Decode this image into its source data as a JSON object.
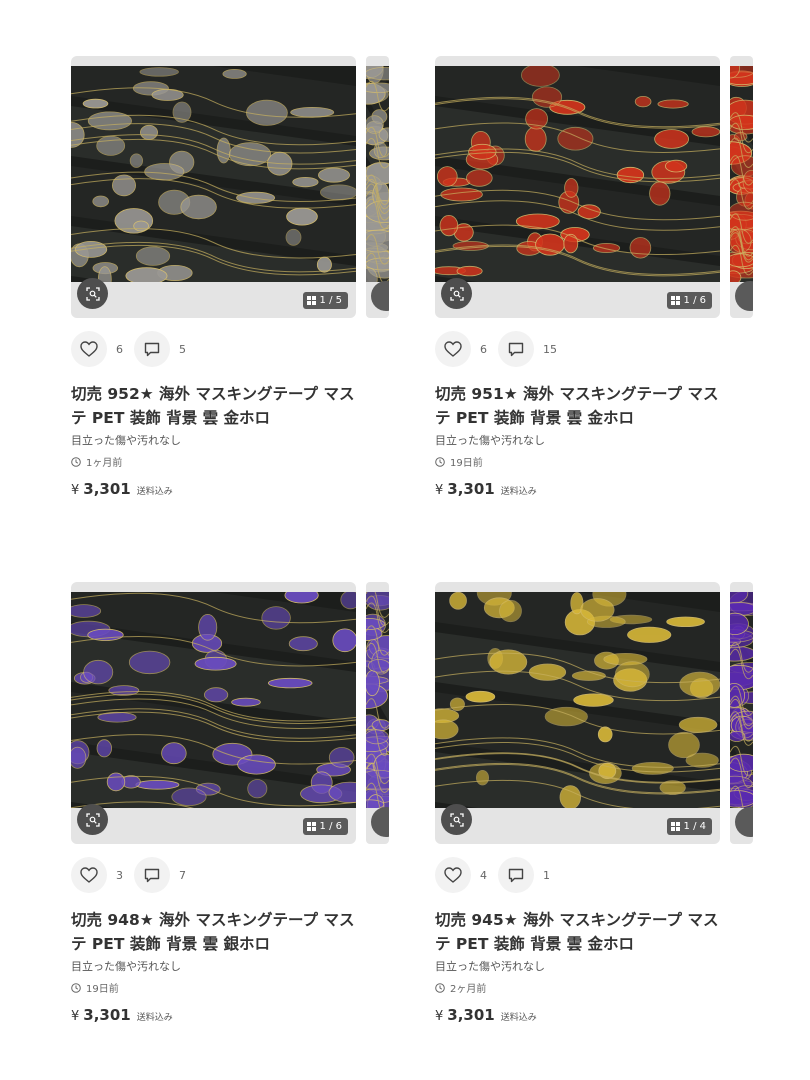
{
  "listings": [
    {
      "title_line1": "切売 952★ 海外 マスキングテープ マス",
      "title_line2": "テ PET 装飾 背景 雲 金ホロ",
      "condition": "目立った傷や汚れなし",
      "posted": "1ヶ月前",
      "price_symbol": "¥",
      "price": "3,301",
      "shipping": "送料込み",
      "likes": "6",
      "comments": "5",
      "image_counter": "1 / 5",
      "cloud_color": "#9a9894"
    },
    {
      "title_line1": "切売 951★ 海外 マスキングテープ マス",
      "title_line2": "テ PET 装飾 背景 雲 金ホロ",
      "condition": "目立った傷や汚れなし",
      "posted": "19日前",
      "price_symbol": "¥",
      "price": "3,301",
      "shipping": "送料込み",
      "likes": "6",
      "comments": "15",
      "image_counter": "1 / 6",
      "cloud_color": "#d2341c"
    },
    {
      "title_line1": "切売 948★ 海外 マスキングテープ マス",
      "title_line2": "テ PET 装飾 背景 雲 銀ホロ",
      "condition": "目立った傷や汚れなし",
      "posted": "19日前",
      "price_symbol": "¥",
      "price": "3,301",
      "shipping": "送料込み",
      "likes": "3",
      "comments": "7",
      "image_counter": "1 / 6",
      "cloud_color": "#6a4cc0"
    },
    {
      "title_line1": "切売 945★ 海外 マスキングテープ マス",
      "title_line2": "テ PET 装飾 背景 雲 金ホロ",
      "condition": "目立った傷や汚れなし",
      "posted": "2ヶ月前",
      "price_symbol": "¥",
      "price": "3,301",
      "shipping": "送料込み",
      "likes": "4",
      "comments": "1",
      "image_counter": "1 / 4",
      "cloud_color": "#d8b838"
    }
  ]
}
